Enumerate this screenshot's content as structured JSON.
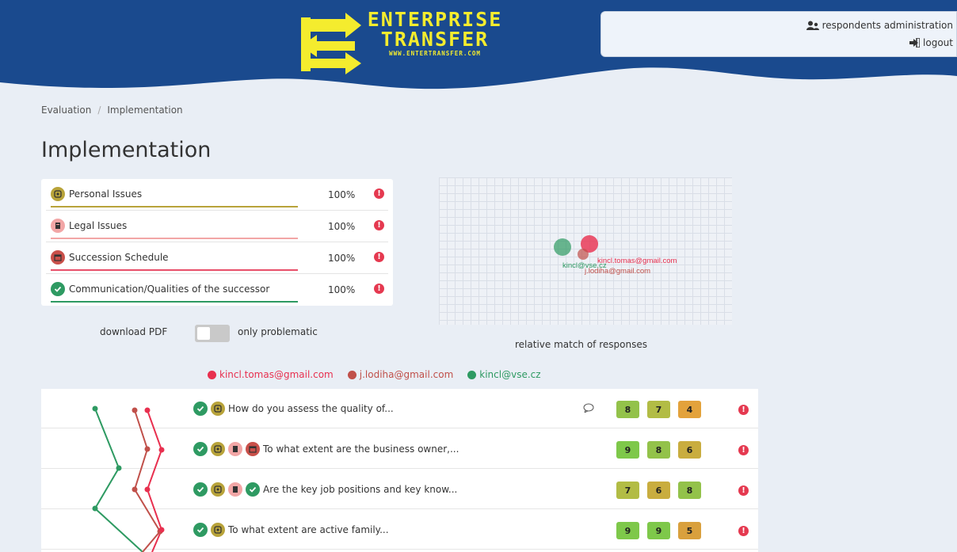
{
  "header": {
    "logo": {
      "line1": "ENTERPRISE",
      "line2": "TRANSFER",
      "line3": "WWW.ENTERTRANSFER.COM"
    },
    "links": {
      "respondents_admin": "respondents administration",
      "logout": "logout"
    },
    "colors": {
      "primary": "#1a4a8e",
      "logo_yellow": "#f4ec2e"
    }
  },
  "breadcrumb": [
    "Evaluation",
    "/",
    "Implementation"
  ],
  "page_title": "Implementation",
  "categories": [
    {
      "label": "Personal Issues",
      "percent": "100%",
      "icon": "person-issues-icon",
      "color": "#b8a33a"
    },
    {
      "label": "Legal Issues",
      "percent": "100%",
      "icon": "legal-icon",
      "color": "#f2a6a6"
    },
    {
      "label": "Succession Schedule",
      "percent": "100%",
      "icon": "calendar-icon",
      "color": "#c9504a"
    },
    {
      "label": "Communication/Qualities of the successor",
      "percent": "100%",
      "icon": "check-icon",
      "color": "#2e9a62"
    }
  ],
  "controls": {
    "download_pdf": "download PDF",
    "only_problematic": "only problematic",
    "only_problematic_on": false
  },
  "match_plot": {
    "caption": "relative match of responses",
    "labels": [
      "kincl.tomas@gmail.com",
      "j.lodiha@gmail.com",
      "kincl@vse.cz"
    ]
  },
  "respondents": [
    {
      "email": "kincl.tomas@gmail.com",
      "color": "#e8304f"
    },
    {
      "email": "j.lodiha@gmail.com",
      "color": "#c0504a"
    },
    {
      "email": "kincl@vse.cz",
      "color": "#2e9a62"
    }
  ],
  "questions": [
    {
      "text": "How do you assess the quality of...",
      "icons": [
        "check-icon",
        "person-issues-icon"
      ],
      "has_comment": true,
      "scores": [
        8,
        7,
        4
      ]
    },
    {
      "text": "To what extent are the business owner,...",
      "icons": [
        "check-icon",
        "person-issues-icon",
        "legal-icon",
        "calendar-icon"
      ],
      "has_comment": false,
      "scores": [
        9,
        8,
        6
      ]
    },
    {
      "text": "Are the key job positions and key know...",
      "icons": [
        "check-icon",
        "person-issues-icon",
        "legal-icon",
        "check-icon"
      ],
      "has_comment": false,
      "scores": [
        7,
        6,
        8
      ]
    },
    {
      "text": "To what extent are active family...",
      "icons": [
        "check-icon",
        "person-issues-icon"
      ],
      "has_comment": false,
      "scores": [
        9,
        9,
        5
      ]
    }
  ]
}
